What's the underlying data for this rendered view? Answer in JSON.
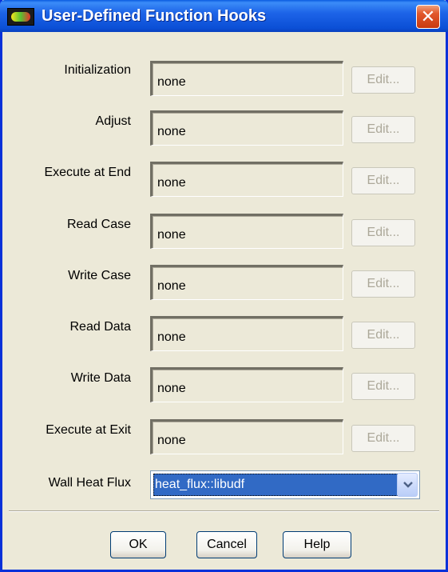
{
  "window": {
    "title": "User-Defined Function Hooks",
    "close_glyph": "✕",
    "app_icon": "fluent-app-icon"
  },
  "hooks": [
    {
      "label": "Initialization",
      "value": "none",
      "button": "Edit..."
    },
    {
      "label": "Adjust",
      "value": "none",
      "button": "Edit..."
    },
    {
      "label": "Execute at End",
      "value": "none",
      "button": "Edit..."
    },
    {
      "label": "Read Case",
      "value": "none",
      "button": "Edit..."
    },
    {
      "label": "Write Case",
      "value": "none",
      "button": "Edit..."
    },
    {
      "label": "Read Data",
      "value": "none",
      "button": "Edit..."
    },
    {
      "label": "Write Data",
      "value": "none",
      "button": "Edit..."
    },
    {
      "label": "Execute at Exit",
      "value": "none",
      "button": "Edit..."
    }
  ],
  "wall_heat_flux": {
    "label": "Wall Heat Flux",
    "selected": "heat_flux::libudf"
  },
  "buttons": {
    "ok": "OK",
    "cancel": "Cancel",
    "help": "Help"
  },
  "colors": {
    "titlebar": "#0b4fd6",
    "selection": "#316ac5",
    "close": "#c93a10"
  }
}
